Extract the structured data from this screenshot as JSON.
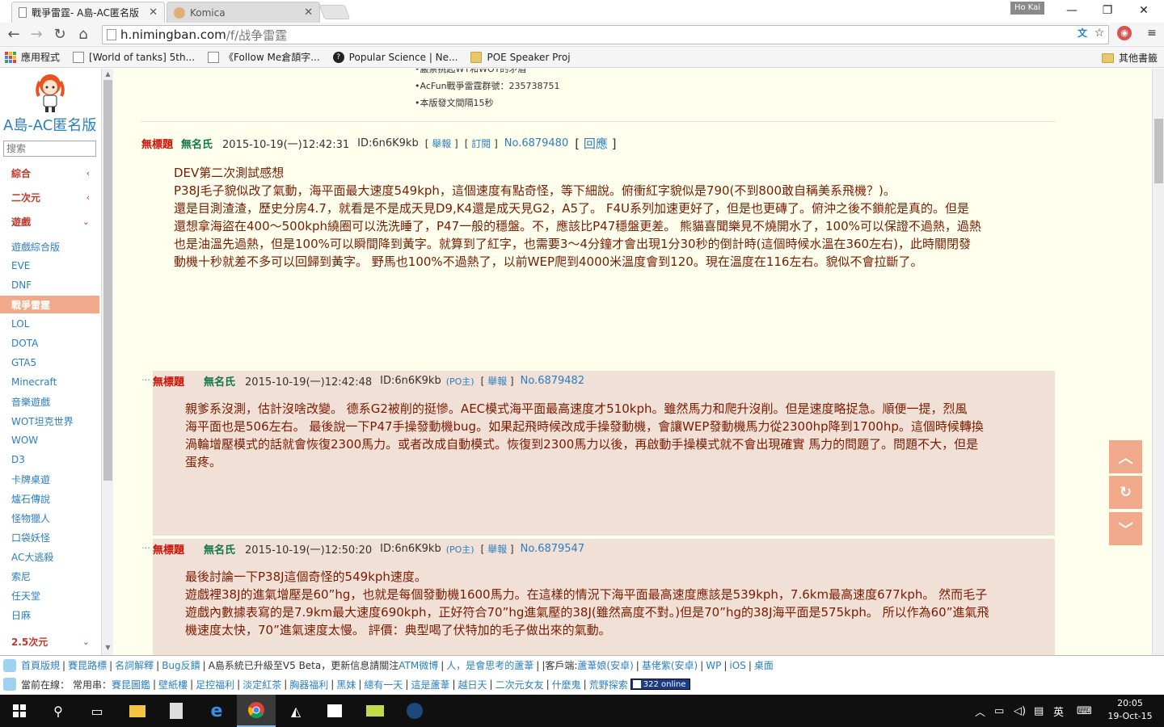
{
  "browser": {
    "tabs": [
      {
        "title": "戰爭雷霆- A島-AC匿名版",
        "active": true
      },
      {
        "title": "Komica",
        "active": false
      }
    ],
    "profile": "Ho Kai",
    "url_host": "h.nimingban.com",
    "url_path": "/f/战争雷霆",
    "bookmarks": [
      {
        "label": "應用程式",
        "icon": "apps-icon"
      },
      {
        "label": "[World of tanks] 5th...",
        "icon": "page-icon"
      },
      {
        "label": "《Follow Me倉頡字...",
        "icon": "page-icon"
      },
      {
        "label": "Popular Science | Ne...",
        "icon": "popsci-icon"
      },
      {
        "label": "POE Speaker Proj",
        "icon": "folder-icon"
      }
    ],
    "other_bookmarks": "其他書籤"
  },
  "sidebar": {
    "site_title": "A島-AC匿名版",
    "search_placeholder": "搜索",
    "sections": [
      {
        "label": "綜合",
        "chevron": "‹"
      },
      {
        "label": "二次元",
        "chevron": "‹"
      },
      {
        "label": "遊戲",
        "chevron": "⌄"
      }
    ],
    "items": [
      "遊戲綜合版",
      "EVE",
      "DNF",
      "戰爭雷霆",
      "LOL",
      "DOTA",
      "GTA5",
      "Minecraft",
      "音樂遊戲",
      "WOT坦克世界",
      "WOW",
      "D3",
      "卡牌桌遊",
      "爐石傳說",
      "怪物獵人",
      "口袋妖怪",
      "AC大逃殺",
      "索尼",
      "任天堂",
      "日麻"
    ],
    "active_item": "戰爭雷霆",
    "bottom_section": {
      "label": "2.5次元",
      "chevron": "⌄"
    }
  },
  "rules": [
    "•嚴禁挑起WT和WOT的矛盾",
    "•AcFun戰爭雷霆群號：235738751",
    "•本版發文間隔15秒"
  ],
  "thread": {
    "title": "無標題",
    "name": "無名氏",
    "datetime": "2015-10-19(一)12:42:31",
    "uid": "ID:6n6K9kb",
    "report": "舉報",
    "subscribe": "訂閱",
    "no": "No.6879480",
    "reply": "回應",
    "body": [
      "DEV第二次測試感想",
      "P38J毛子貌似改了氣動，海平面最大速度549kph，這個速度有點奇怪，等下細說。俯衝紅字貌似是790(不到800敢自稱美系飛機？)。",
      "還是目測渣渣，歷史分房4.7，就看是不是成天見D9,K4還是成天見G2，A5了。 F4U系列加速更好了，但是也更磚了。俯沖之後不鎖舵是真的。但是",
      "還想拿海盜在400～500kph繞圈可以洗洗睡了，P47一般的穩盤。不，應該比P47穩盤更差。 熊貓喜聞樂見不燒開水了，100%可以保證不過熱，過熱",
      "也是油溫先過熱，但是100%可以瞬間降到黃字。就算到了紅字，也需要3～4分鐘才會出現1分30秒的倒計時(這個時候水溫在360左右)，此時關閉發",
      "動機十秒就差不多可以回歸到黃字。 野馬也100%不過熱了，以前WEP爬到4000米溫度會到120。現在溫度在116左右。貌似不會拉斷了。"
    ]
  },
  "replies": [
    {
      "title": "無標題",
      "name": "無名氏",
      "datetime": "2015-10-19(一)12:42:48",
      "uid": "ID:6n6K9kb",
      "po": "(PO主)",
      "report": "舉報",
      "no": "No.6879482",
      "body": [
        "親爹系沒測，估計沒啥改變。 德系G2被削的挺慘。AEC模式海平面最高速度才510kph。雖然馬力和爬升沒削。但是速度略捉急。順便一提，烈風",
        "海平面也是506左右。 最後說一下P47手操發動機bug。如果起飛時候改成手操發動機，會讓WEP發動機馬力從2300hp降到1700hp。這個時候轉換",
        "渦輪增壓模式的話就會恢復2300馬力。或者改成自動模式。恢復到2300馬力以後，再啟動手操模式就不會出現確實 馬力的問題了。問題不大，但是",
        "蛋疼。"
      ]
    },
    {
      "title": "無標題",
      "name": "無名氏",
      "datetime": "2015-10-19(一)12:50:20",
      "uid": "ID:6n6K9kb",
      "po": "(PO主)",
      "report": "舉報",
      "no": "No.6879547",
      "body": [
        "最後討論一下P38J這個奇怪的549kph速度。",
        "遊戲裡38J的進氣增壓是60”hg，也就是每個發動機1600馬力。在這樣的情況下海平面最高速度應該是539kph，7.6km最高速度677kph。 然而毛子",
        "遊戲內數據表寫的是7.9km最大速度690kph，正好符合70”hg進氣壓的38J(雖然高度不對。)但是70”hg的38J海平面是575kph。 所以作為60”進氣飛",
        "機速度太快，70”進氣速度太慢。 評價：典型喝了伏特加的毛子做出來的氣動。"
      ]
    }
  ],
  "footer": {
    "links1": [
      "首頁版規",
      "賽昆路標",
      "名詞解釋",
      "Bug反饋"
    ],
    "notice_prefix": "A島系統已升級至V5 Beta，更新信息請關注",
    "notice_link": "ATM微博",
    "notice_mid": "人，是會思考的蘆葦",
    "client_label": "|客戶端:",
    "clients": [
      "蘆葦娘(安卓)",
      "基佬紫(安卓)",
      "WP",
      "iOS",
      "桌面"
    ],
    "online_label": "當前在線：",
    "common_label": "常用串：",
    "common_links": [
      "賽昆圖鑑",
      "壁紙樓",
      "足控福利",
      "淡定紅茶",
      "胸器福利",
      "黑妹",
      "總有一天",
      "這是蘆葦",
      "越日天",
      "二次元女友",
      "什麼鬼",
      "荒野探索"
    ],
    "online_count": "322 online"
  },
  "taskbar": {
    "time": "20:05",
    "date": "19-Oct-15",
    "ime": "英"
  },
  "colors": {
    "accent": "#f0a98a",
    "link": "#2a7fc1",
    "title_red": "#cc1105",
    "name_green": "#117743",
    "post_text": "#7c1a00",
    "page_bg": "#ffffee",
    "reply_bg": "#f0e0d6"
  }
}
